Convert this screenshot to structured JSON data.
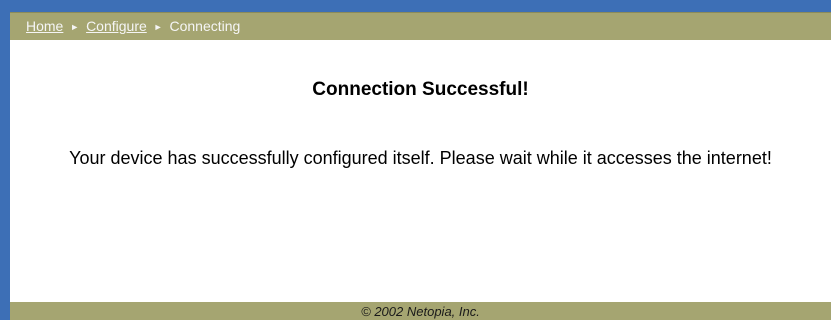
{
  "breadcrumb": {
    "home_label": "Home",
    "configure_label": "Configure",
    "current_label": "Connecting",
    "separator": "►"
  },
  "main": {
    "heading": "Connection Successful!",
    "message": "Your device has successfully configured itself. Please wait while it accesses the internet!"
  },
  "footer": {
    "copyright": "© 2002 Netopia, Inc."
  },
  "colors": {
    "window_edge": "#3d6fb6",
    "bar_background": "#a5a571",
    "page_background": "#ffffff"
  }
}
